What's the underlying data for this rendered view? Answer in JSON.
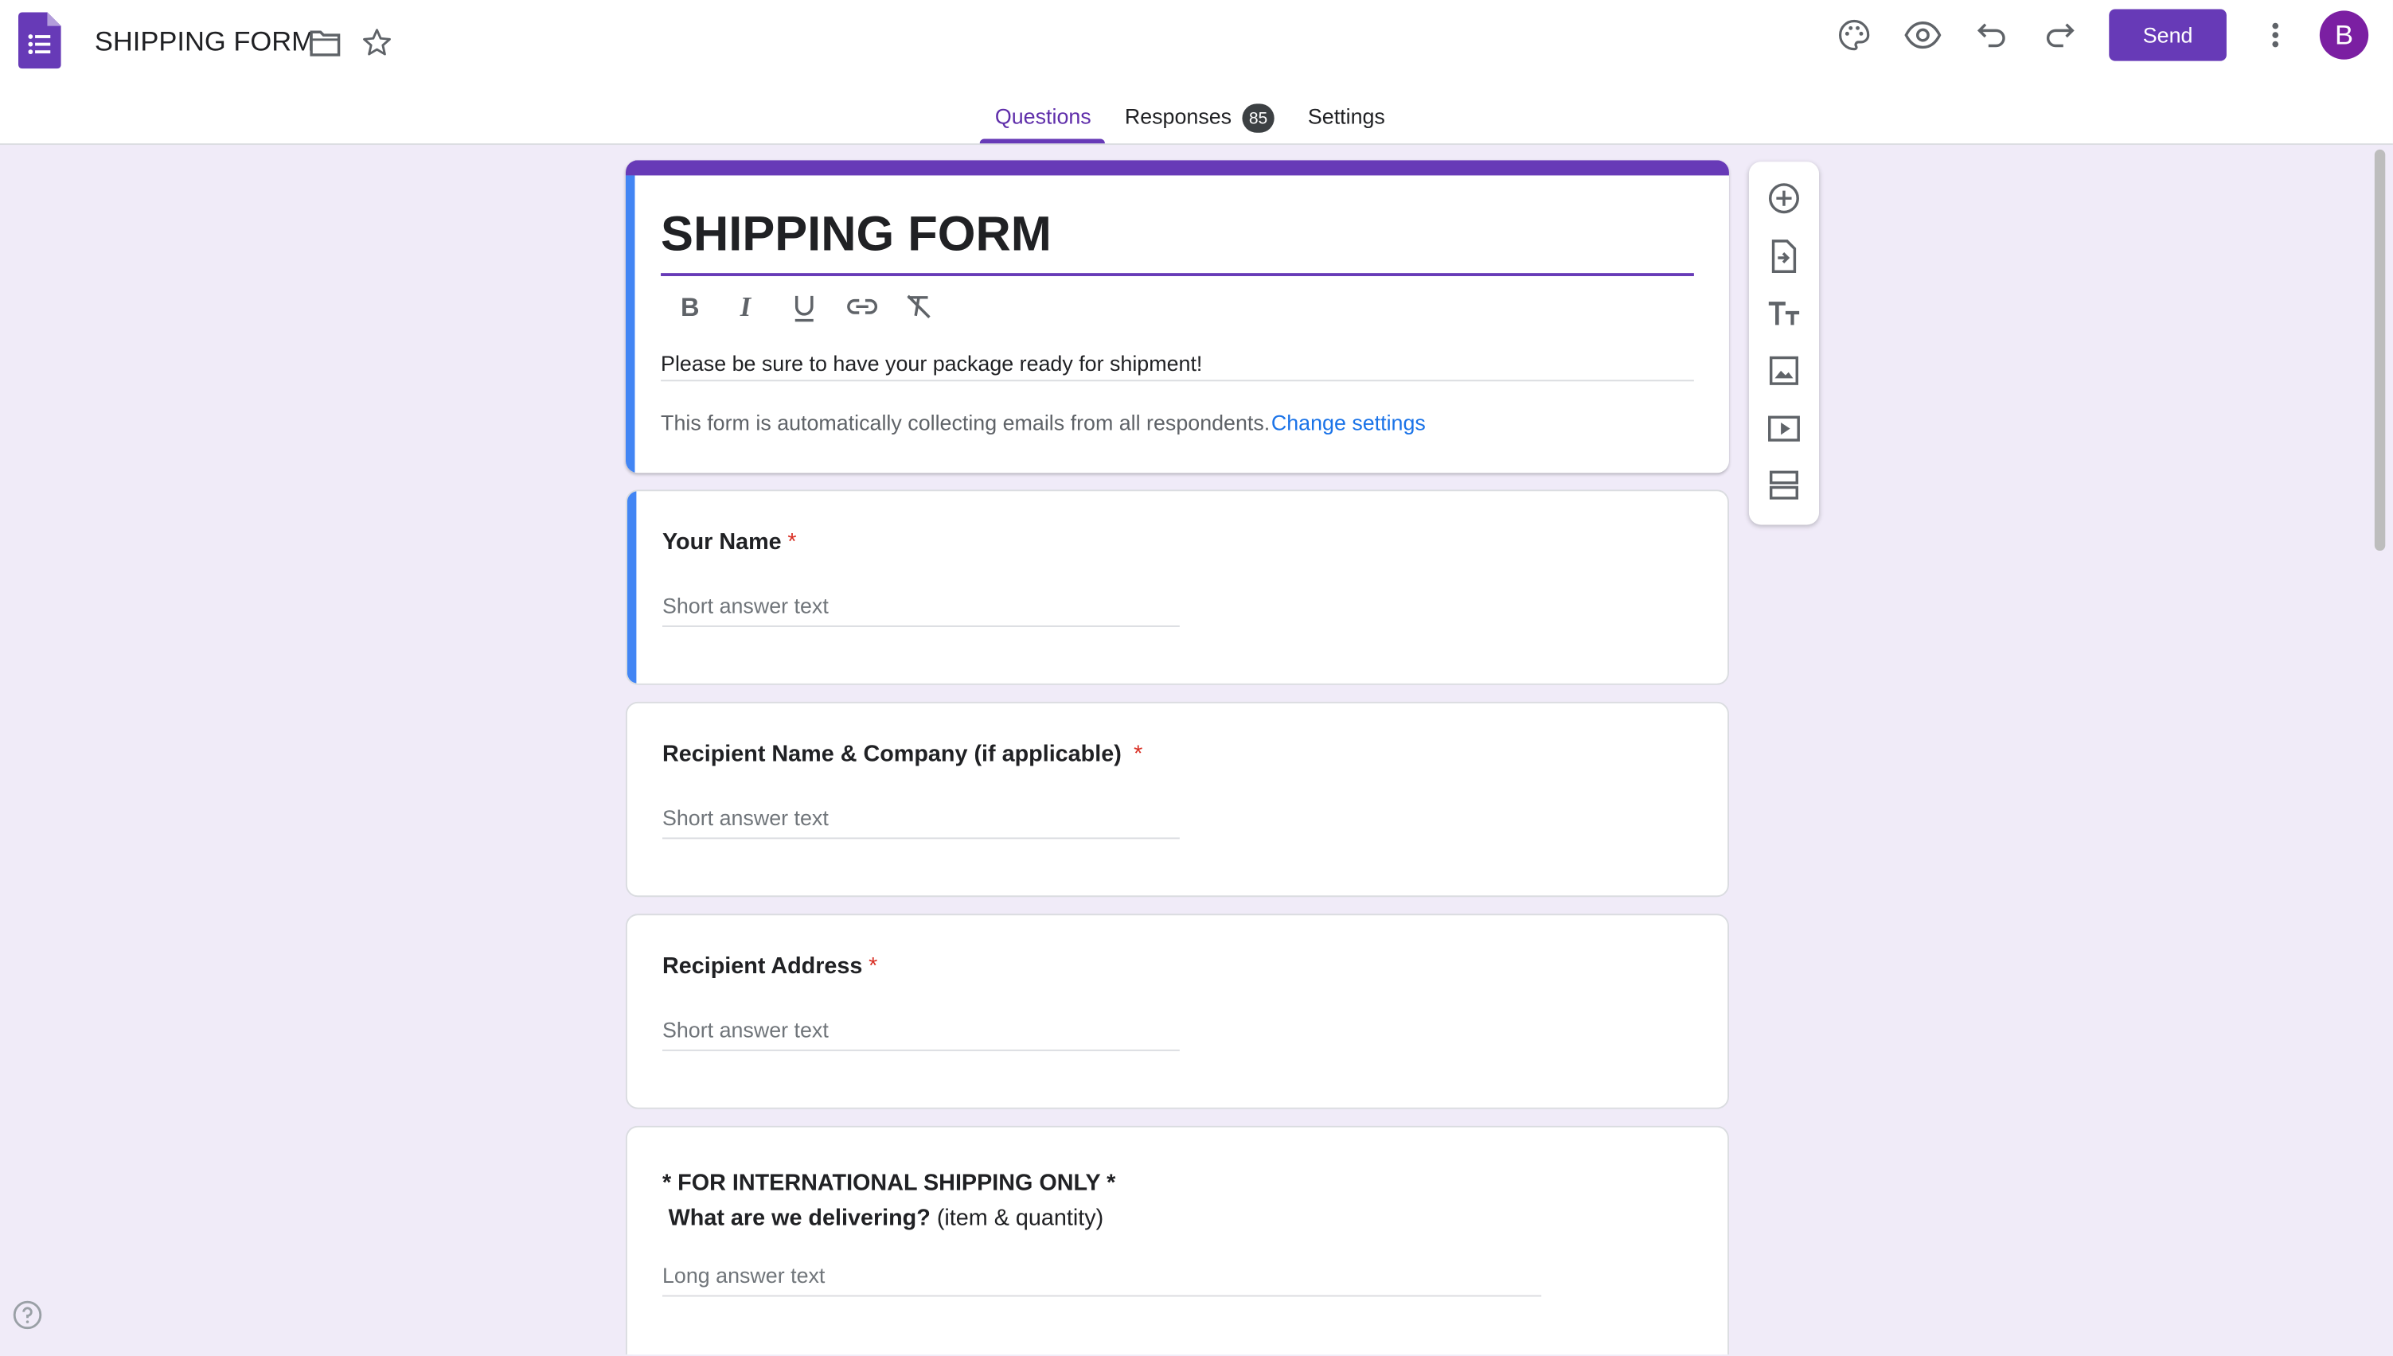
{
  "header": {
    "doc_title": "SHIPPING FORM",
    "send_label": "Send",
    "avatar_letter": "B",
    "accent_color": "#673ab7"
  },
  "tabs": [
    {
      "label": "Questions",
      "active": true
    },
    {
      "label": "Responses",
      "badge": "85"
    },
    {
      "label": "Settings"
    }
  ],
  "form": {
    "title": "SHIPPING FORM",
    "description": "Please be sure to have your package ready for shipment!",
    "email_note": "This form is automatically collecting emails from all respondents.",
    "change_settings": "Change settings"
  },
  "questions": [
    {
      "title": "Your Name",
      "required_mark": "*",
      "placeholder": "Short answer text"
    },
    {
      "title": "Recipient Name & Company (if applicable)",
      "required_mark": "*",
      "placeholder": "Short answer text"
    },
    {
      "title": "Recipient Address",
      "required_mark": "*",
      "placeholder": "Short answer text"
    },
    {
      "title_line1": "* FOR INTERNATIONAL SHIPPING ONLY *",
      "title_line2_bold": "What are we delivering?",
      "title_line2_rest": " (item & quantity)",
      "placeholder": "Long answer text"
    }
  ],
  "side_toolbar": [
    "add-question-icon",
    "import-questions-icon",
    "add-title-icon",
    "add-image-icon",
    "add-video-icon",
    "add-section-icon"
  ],
  "header_icons": [
    "folder-icon",
    "star-icon",
    "palette-icon",
    "preview-icon",
    "undo-icon",
    "redo-icon",
    "more-vert-icon"
  ]
}
